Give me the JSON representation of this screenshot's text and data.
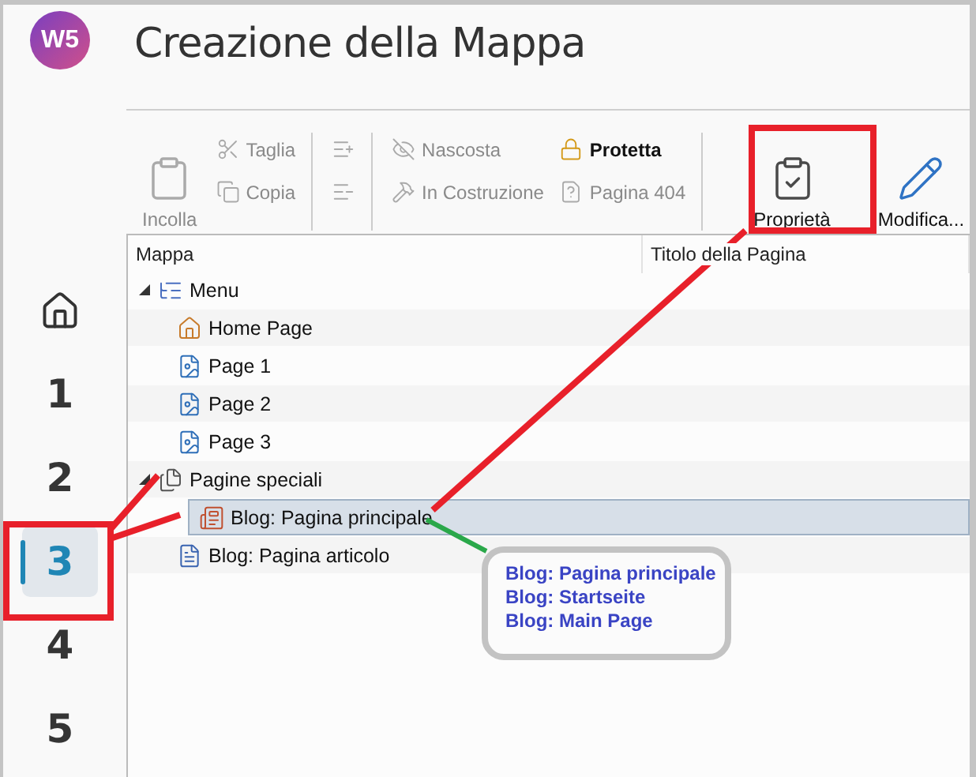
{
  "app": {
    "logo": "W5",
    "title": "Creazione della Mappa"
  },
  "nav": [
    {
      "kind": "home",
      "selected": false
    },
    {
      "kind": "step",
      "label": "1",
      "selected": false
    },
    {
      "kind": "step",
      "label": "2",
      "selected": false
    },
    {
      "kind": "step",
      "label": "3",
      "selected": true
    },
    {
      "kind": "step",
      "label": "4",
      "selected": false
    },
    {
      "kind": "step",
      "label": "5",
      "selected": false
    }
  ],
  "toolbar": {
    "groups": [
      {
        "columns": [
          [
            {
              "kind": "large",
              "label": "Incolla",
              "disabled": true
            }
          ],
          [
            {
              "kind": "small",
              "label": "Taglia",
              "disabled": true
            },
            {
              "kind": "small",
              "label": "Copia",
              "disabled": true
            }
          ]
        ]
      },
      {
        "columns": [
          [
            {
              "kind": "icon",
              "disabled": true
            },
            {
              "kind": "icon",
              "disabled": true
            }
          ]
        ]
      },
      {
        "columns": [
          [
            {
              "kind": "small",
              "label": "Nascosta",
              "disabled": true
            },
            {
              "kind": "small",
              "label": "In Costruzione",
              "disabled": true
            }
          ],
          [
            {
              "kind": "small",
              "label": "Protetta",
              "disabled": false
            },
            {
              "kind": "small",
              "label": "Pagina 404",
              "disabled": true
            }
          ]
        ]
      },
      {
        "columns": [
          [
            {
              "kind": "large",
              "label": "Proprietà",
              "disabled": false
            }
          ],
          [
            {
              "kind": "large",
              "label": "Modifica...",
              "disabled": false
            }
          ]
        ]
      }
    ]
  },
  "tree": {
    "columns": [
      "Mappa",
      "Titolo della Pagina"
    ],
    "rows": [
      {
        "kind": "menu",
        "label": "Menu",
        "expanded": true,
        "selected": false,
        "children": [
          {
            "kind": "home",
            "label": "Home Page",
            "selected": false
          },
          {
            "kind": "page",
            "label": "Page 1",
            "selected": false
          },
          {
            "kind": "page",
            "label": "Page 2",
            "selected": false
          },
          {
            "kind": "page",
            "label": "Page 3",
            "selected": false
          }
        ]
      },
      {
        "kind": "special",
        "label": "Pagine speciali",
        "expanded": true,
        "selected": false,
        "children": [
          {
            "kind": "blog-home",
            "label": "Blog: Pagina principale",
            "selected": true
          },
          {
            "kind": "blog-article",
            "label": "Blog: Pagina articolo",
            "selected": false
          }
        ]
      }
    ]
  },
  "callout": {
    "lines": [
      "Blog: Pagina principale",
      "Blog: Startseite",
      "Blog: Main Page"
    ]
  }
}
